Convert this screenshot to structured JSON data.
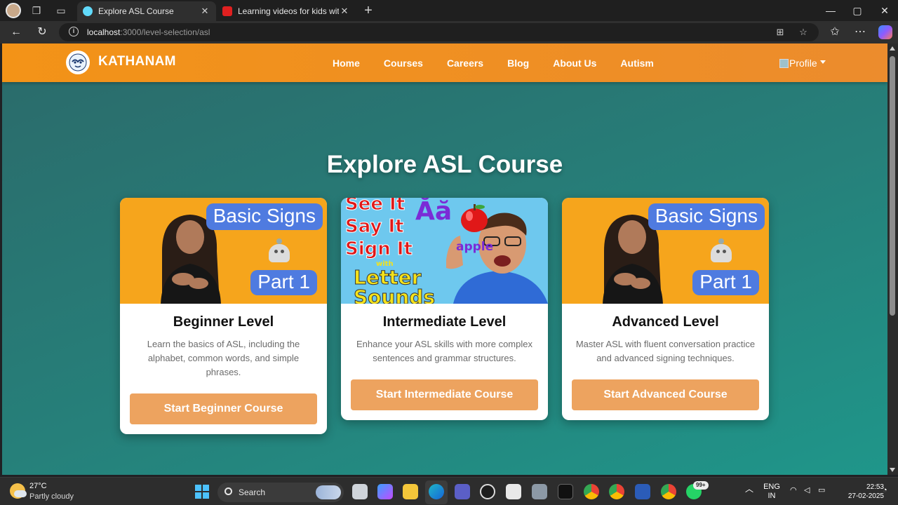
{
  "browser": {
    "tabs": [
      {
        "title": "Explore ASL Course",
        "active": true
      },
      {
        "title": "Learning videos for kids with autis",
        "active": false
      }
    ],
    "url_host": "localhost",
    "url_rest": ":3000/level-selection/asl"
  },
  "navbar": {
    "brand": "KATHANAM",
    "links": [
      "Home",
      "Courses",
      "Careers",
      "Blog",
      "About Us",
      "Autism"
    ],
    "profile_label": "Profile"
  },
  "main": {
    "heading": "Explore ASL Course",
    "cards": [
      {
        "title": "Beginner Level",
        "description": "Learn the basics of ASL, including the alphabet, common words, and simple phrases.",
        "button": "Start Beginner Course",
        "thumb": {
          "line1": "Basic Signs",
          "line2": "Part 1"
        }
      },
      {
        "title": "Intermediate Level",
        "description": "Enhance your ASL skills with more complex sentences and grammar structures.",
        "button": "Start Intermediate Course",
        "thumb": {
          "l1": "See It",
          "l2": "Say It",
          "l3": "Sign It",
          "letters": "Ăă",
          "word": "apple",
          "with": "with",
          "l4": "Letter",
          "l5": "Sounds"
        }
      },
      {
        "title": "Advanced Level",
        "description": "Master ASL with fluent conversation practice and advanced signing techniques.",
        "button": "Start Advanced Course",
        "thumb": {
          "line1": "Basic Signs",
          "line2": "Part 1"
        }
      }
    ]
  },
  "taskbar": {
    "temperature": "27°C",
    "condition": "Partly cloudy",
    "search_label": "Search",
    "notification_badge": "99+",
    "language": "ENG",
    "region": "IN",
    "time": "22:53",
    "date": "27-02-2025"
  },
  "colors": {
    "navbar": "#f39317",
    "button": "#eda35f",
    "background": "#26807a"
  }
}
